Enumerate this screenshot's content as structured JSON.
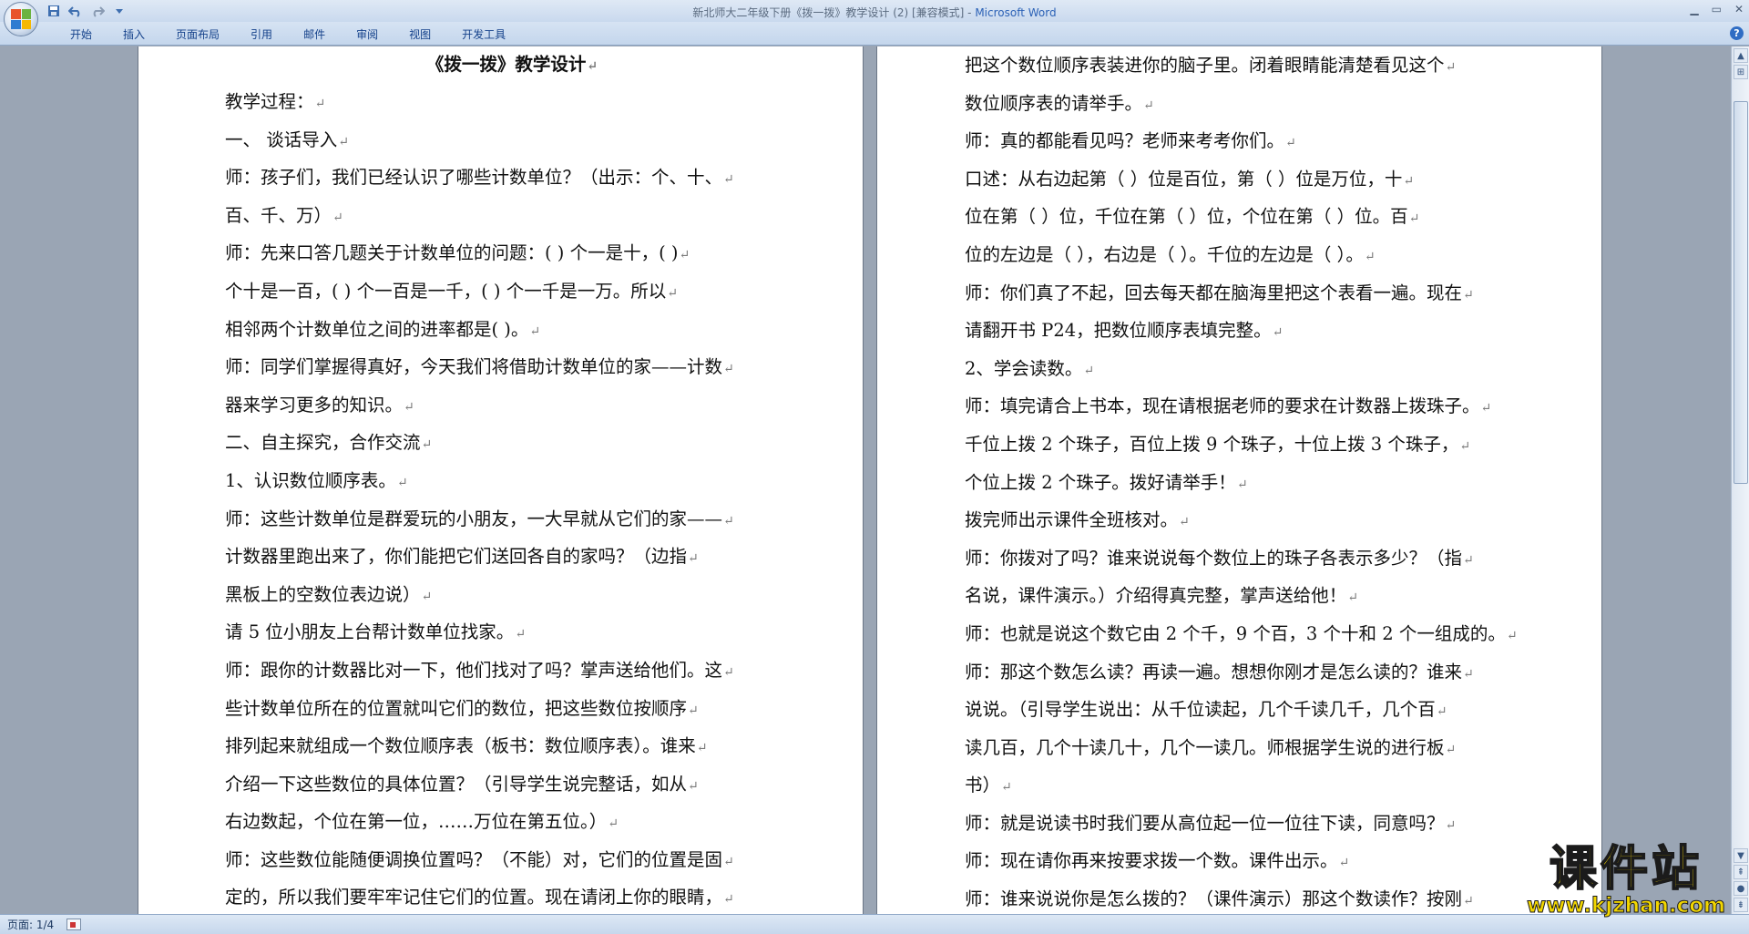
{
  "window": {
    "title_doc": "新北师大二年级下册《拨一拨》教学设计 (2) [兼容模式] - ",
    "title_app": "Microsoft Word"
  },
  "quick_access": [
    "save-icon",
    "undo-icon",
    "redo-icon",
    "customize-icon"
  ],
  "ribbon": {
    "tabs": [
      "开始",
      "插入",
      "页面布局",
      "引用",
      "邮件",
      "审阅",
      "视图",
      "开发工具"
    ]
  },
  "document": {
    "left_page": [
      "《拨一拨》教学设计",
      "教学过程：",
      "一、  谈话导入",
      "师：孩子们，我们已经认识了哪些计数单位？（出示：个、十、",
      "    百、千、万）",
      "师：先来口答几题关于计数单位的问题：(   ) 个一是十，(   )",
      "   个十是一百，(  ) 个一百是一千，(   ) 个一千是一万。所以",
      "   相邻两个计数单位之间的进率都是(     )。",
      "师：同学们掌握得真好，今天我们将借助计数单位的家——计数",
      "    器来学习更多的知识。",
      "二、自主探究，合作交流",
      "1、认识数位顺序表。",
      "师：这些计数单位是群爱玩的小朋友，一大早就从它们的家——",
      "    计数器里跑出来了，你们能把它们送回各自的家吗？（边指",
      "    黑板上的空数位表边说）",
      "    请 5  位小朋友上台帮计数单位找家。",
      "师：跟你的计数器比对一下，他们找对了吗？掌声送给他们。这",
      "    些计数单位所在的位置就叫它们的数位，把这些数位按顺序",
      "    排列起来就组成一个数位顺序表（板书：数位顺序表）。谁来",
      "    介绍一下这些数位的具体位置？（引导学生说完整话，如从",
      "    右边数起，个位在第一位，……万位在第五位。）",
      "师：这些数位能随便调换位置吗？（不能）对，它们的位置是固",
      "   定的，所以我们要牢牢记住它们的位置。现在请闭上你的眼睛，"
    ],
    "right_page": [
      "    把这个数位顺序表装进你的脑子里。闭着眼睛能清楚看见这个",
      "    数位顺序表的请举手。",
      "师：真的都能看见吗？老师来考考你们。",
      "    口述：从右边起第（   ）位是百位，第（    ）位是万位，十",
      "    位在第（   ）位，千位在第（   ）位，个位在第（   ）位。百",
      "    位的左边是（   ），右边是（   ）。千位的左边是（   ）。",
      "师：你们真了不起，回去每天都在脑海里把这个表看一遍。现在",
      "    请翻开书 P24，把数位顺序表填完整。",
      "2、学会读数。",
      "师：填完请合上书本，现在请根据老师的要求在计数器上拨珠子。",
      "    千位上拨 2 个珠子，百位上拨 9 个珠子，十位上拨 3 个珠子，",
      "    个位上拨 2 个珠子。拨好请举手！",
      "    拨完师出示课件全班核对。",
      "师：你拨对了吗？谁来说说每个数位上的珠子各表示多少？（指",
      "    名说，课件演示。）介绍得真完整，掌声送给他！",
      "师：也就是说这个数它由 2 个千，9 个百，3 个十和 2 个一组成的。",
      "师：那这个数怎么读？再读一遍。想想你刚才是怎么读的？谁来",
      "    说说。（引导学生说出：从千位读起，几个千读几千，几个百",
      "    读几百，几个十读几十，几个一读几。师根据学生说的进行板",
      "    书）",
      "师：就是说读书时我们要从高位起一位一位往下读，同意吗？",
      "师：现在请你再来按要求拨一个数。课件出示。",
      "师：谁来说说你是怎么拨的？（课件演示）那这个数读作？按刚"
    ]
  },
  "status": {
    "page": "页面: 1/4"
  },
  "watermark": {
    "cn": "课件站",
    "url": "www.kjzhan.com"
  },
  "colors": {
    "accent": "#2b61b6",
    "ribbon": "#c4d6ec",
    "workspace": "#9aa5b4",
    "watermark": "#f2d600"
  }
}
